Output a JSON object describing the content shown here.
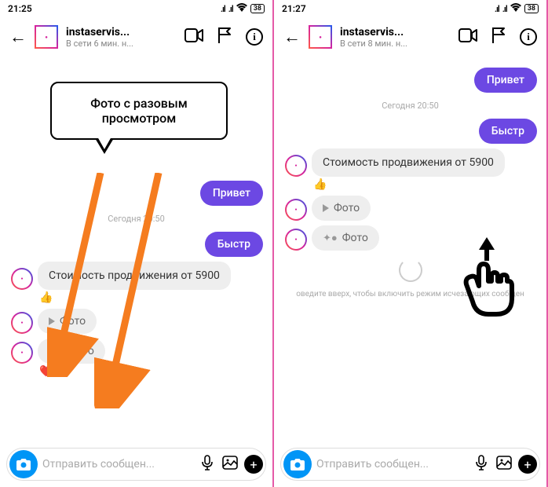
{
  "panels": [
    {
      "status": {
        "time": "21:25",
        "battery": "38"
      },
      "header": {
        "username": "instaservis...",
        "status": "В сети 6 мин. н..."
      },
      "tooltip": "Фото с разовым просмотром",
      "msg_own1": "Привет",
      "timestamp": "Сегодня 20:50",
      "msg_own2": "Быстр",
      "msg_other1": "Стоимость продвижения от 5900",
      "reaction1": "👍",
      "photo1": "Фото",
      "photo2": "Фото",
      "reaction2": "❤️",
      "input_placeholder": "Отправить сообщен..."
    },
    {
      "status": {
        "time": "21:27",
        "battery": "38"
      },
      "header": {
        "username": "instaservis...",
        "status": "В сети 8 мин. н..."
      },
      "msg_own1": "Привет",
      "timestamp": "Сегодня 20:50",
      "msg_own2": "Быстр",
      "msg_other1": "Стоимость продвижения от 5900",
      "reaction1": "👍",
      "photo1": "Фото",
      "photo2": "Фото",
      "hint": "оведите вверх, чтобы включить режим исчезающих сообщен",
      "input_placeholder": "Отправить сообщен..."
    }
  ]
}
